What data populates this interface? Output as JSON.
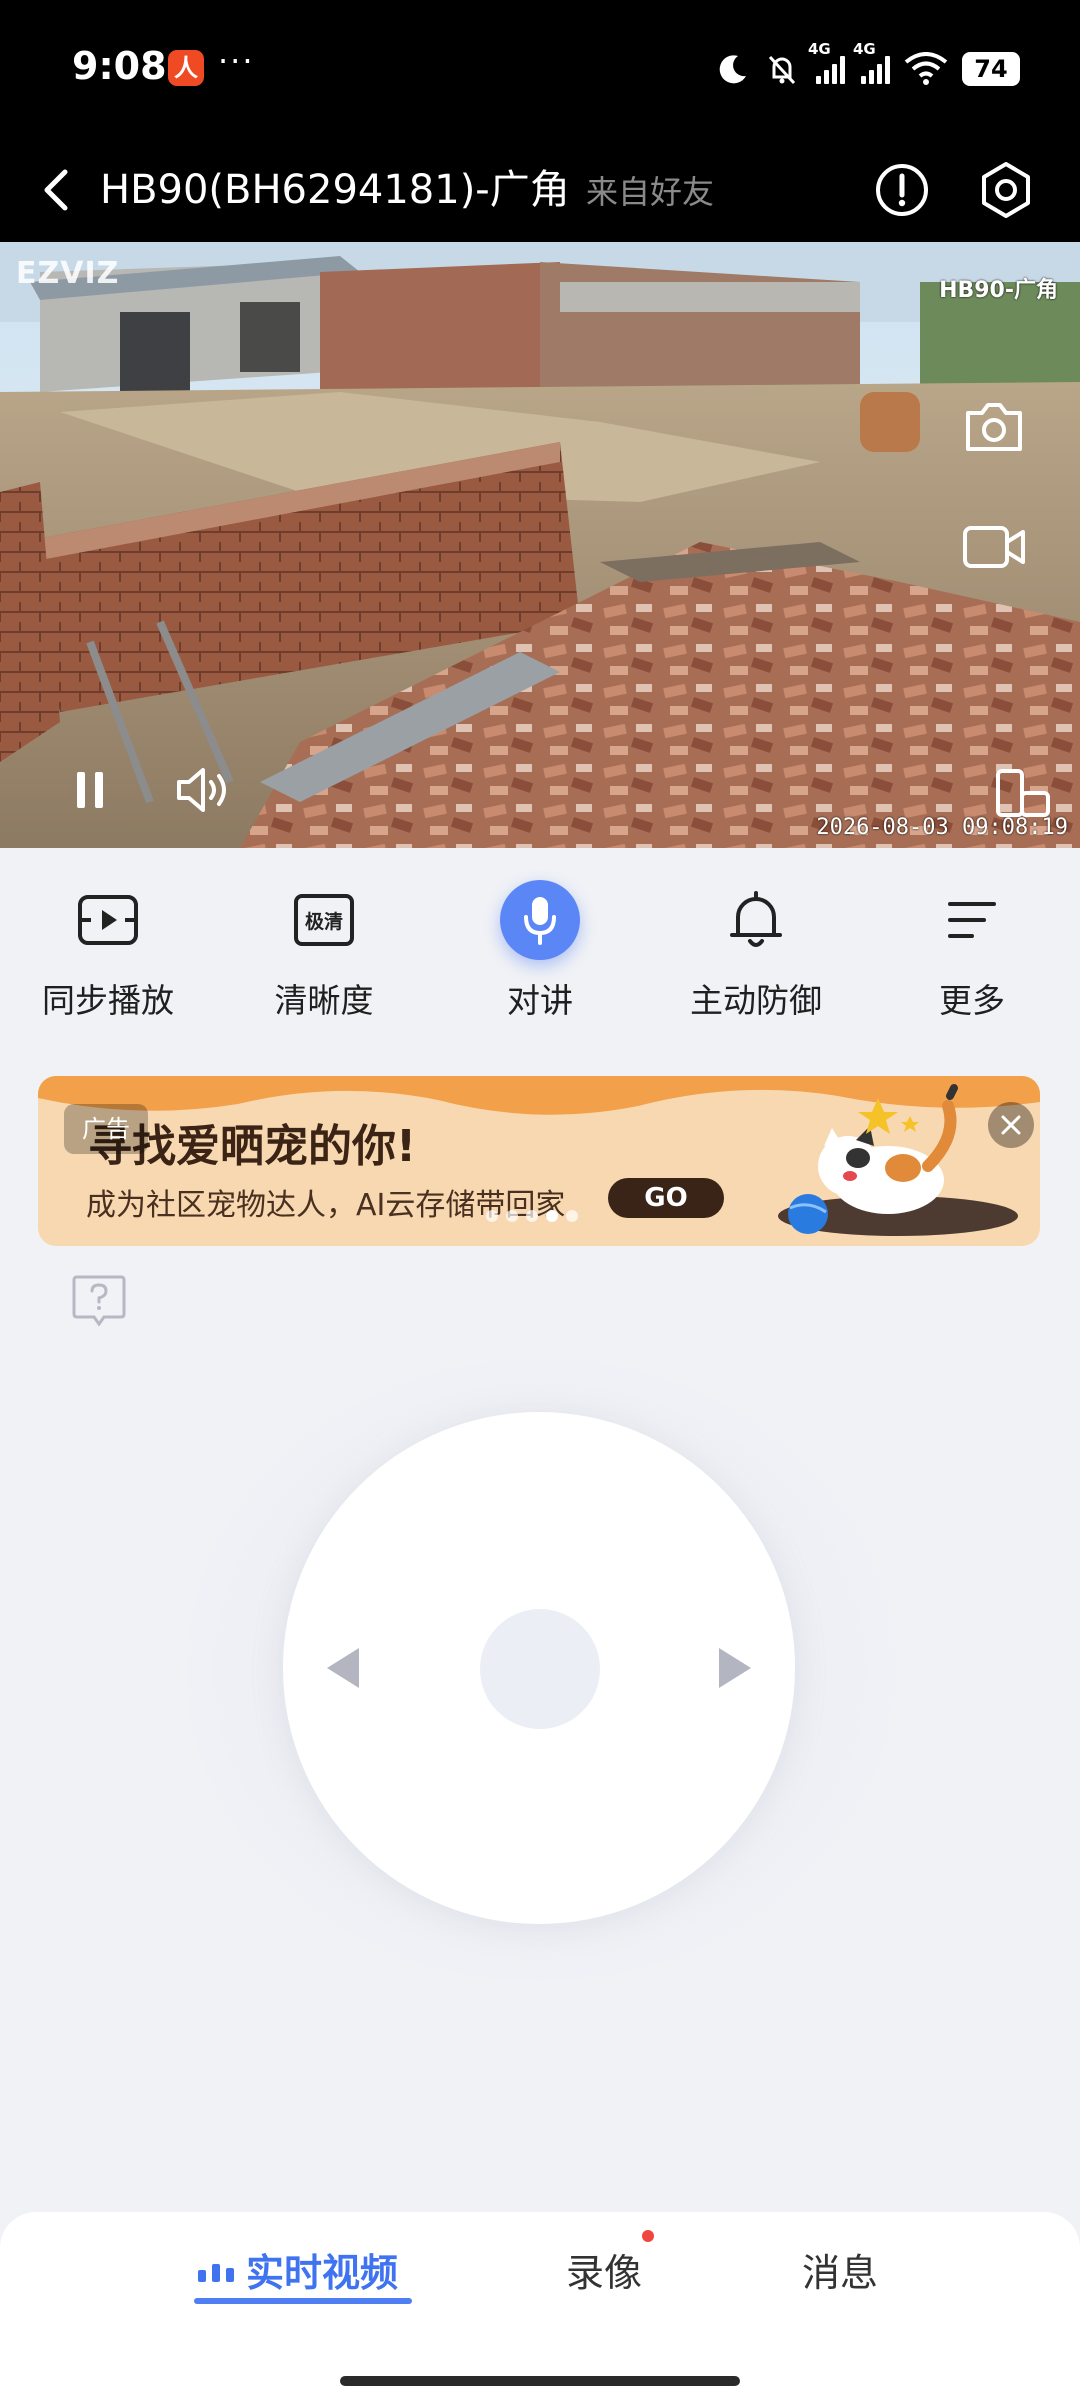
{
  "status_bar": {
    "time": "9:08",
    "app_badge": "人",
    "more": "···",
    "sim1": "4G",
    "sim2": "4G",
    "battery": "74"
  },
  "header": {
    "title": "HB90(BH6294181)-广角",
    "subtitle": "来自好友"
  },
  "video": {
    "watermark_logo": "EZVIZ",
    "camera_name": "HB90-广角",
    "timestamp": "2026-08-03 09:08:19"
  },
  "toolbar": {
    "items": [
      {
        "label": "同步播放",
        "icon": "sync-play-icon"
      },
      {
        "label": "清晰度",
        "icon": "quality-icon",
        "badge": "极清"
      },
      {
        "label": "对讲",
        "icon": "microphone-icon"
      },
      {
        "label": "主动防御",
        "icon": "bell-icon"
      },
      {
        "label": "更多",
        "icon": "menu-icon"
      }
    ]
  },
  "ad": {
    "tag": "广告",
    "title": "寻找爱晒宠的你!",
    "subtitle": "成为社区宠物达人，AI云存储带回家",
    "cta": "GO",
    "active_dot": 3
  },
  "tabs": {
    "items": [
      {
        "label": "实时视频",
        "active": true
      },
      {
        "label": "录像",
        "active": false,
        "badge": "red-dot"
      },
      {
        "label": "消息",
        "active": false
      }
    ]
  },
  "colors": {
    "accent": "#3f73f0",
    "mic": "#5b86f5",
    "background": "#f1f2f6",
    "badge_red": "#f0463e"
  }
}
